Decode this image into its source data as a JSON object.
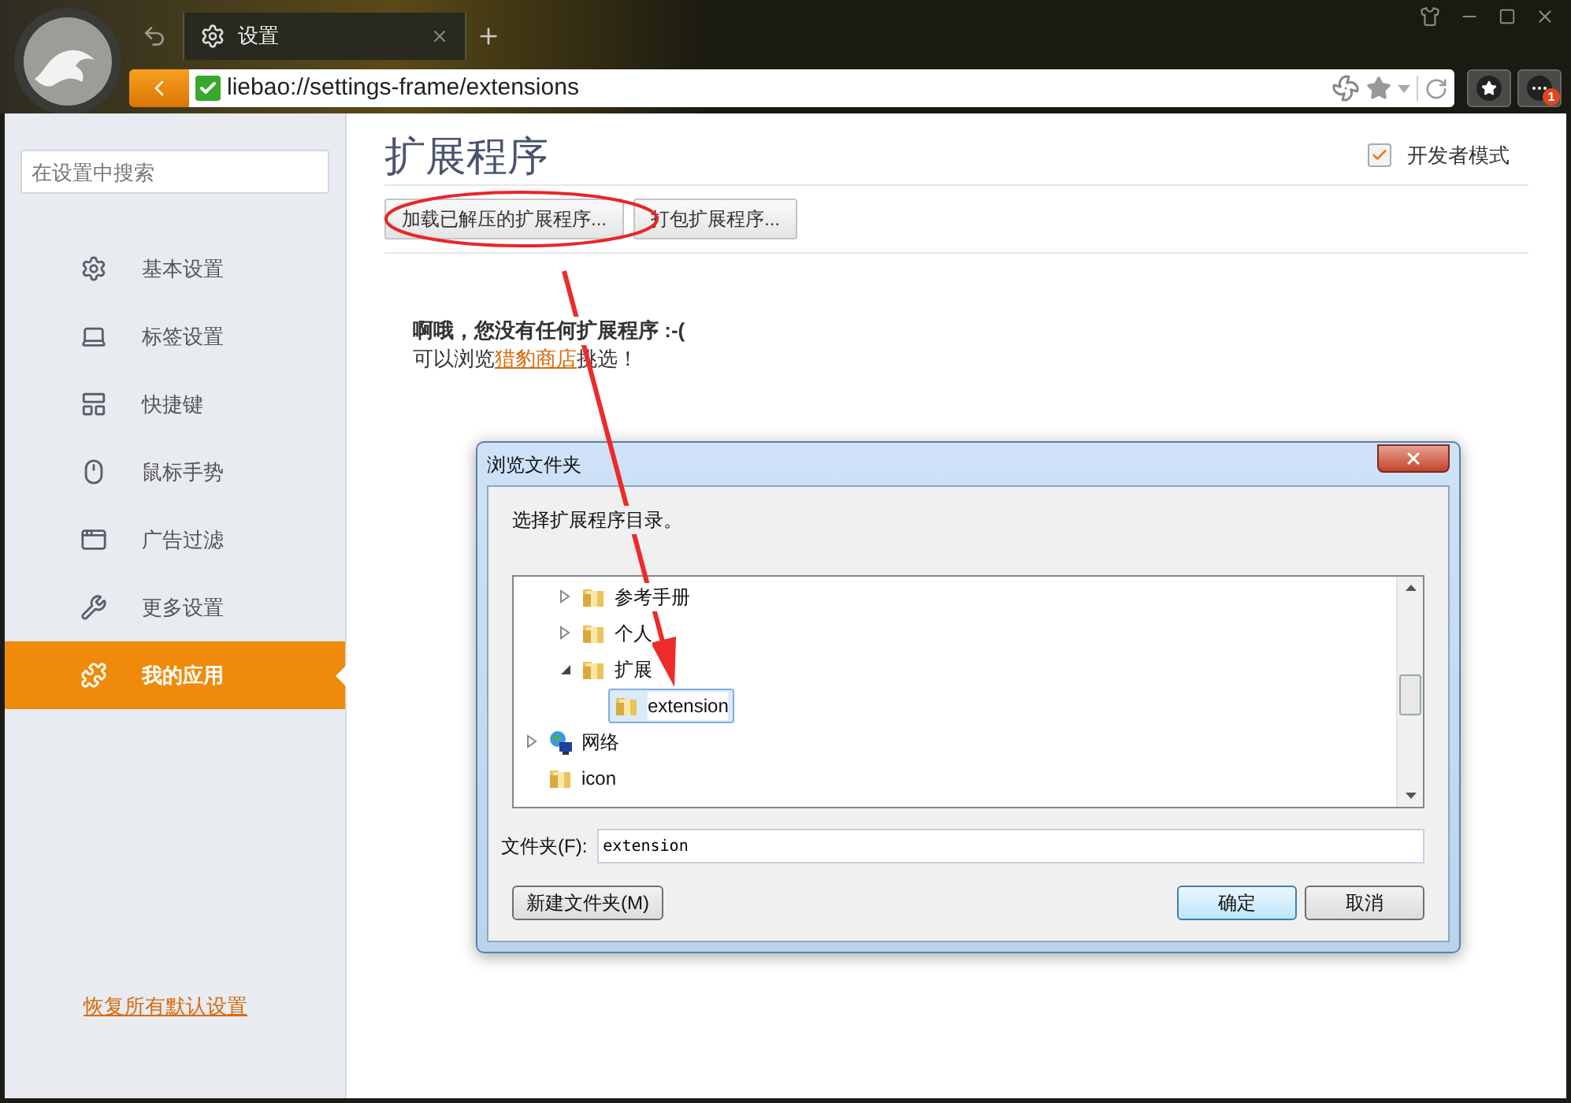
{
  "browser": {
    "tab": {
      "title": "设置",
      "selected": true
    },
    "address": "liebao://settings-frame/extensions",
    "notification_badge": "1"
  },
  "sidebar": {
    "search": {
      "placeholder": "在设置中搜索"
    },
    "items": [
      {
        "label": "基本设置",
        "selected": false
      },
      {
        "label": "标签设置",
        "selected": false
      },
      {
        "label": "快捷键",
        "selected": false
      },
      {
        "label": "鼠标手势",
        "selected": false
      },
      {
        "label": "广告过滤",
        "selected": false
      },
      {
        "label": "更多设置",
        "selected": false
      },
      {
        "label": "我的应用",
        "selected": true
      }
    ],
    "reset_link": "恢复所有默认设置"
  },
  "content": {
    "title": "扩展程序",
    "developer_mode": {
      "label": "开发者模式",
      "checked": true
    },
    "buttons": [
      "加载已解压的扩展程序...",
      "打包扩展程序..."
    ],
    "empty_message": "啊哦，您没有任何扩展程序 :-(",
    "hint": {
      "before": "可以浏览",
      "link": "猎豹商店",
      "after": "挑选！"
    }
  },
  "dialog": {
    "title": "浏览文件夹",
    "prompt": "选择扩展程序目录。",
    "tree": [
      {
        "children": [
          {
            "label": "参考手册",
            "kind": "folder",
            "expandable": true,
            "expanded": false,
            "selected": false
          },
          {
            "label": "个人",
            "kind": "folder",
            "expandable": true,
            "expanded": false,
            "selected": false
          },
          {
            "label": "扩展",
            "kind": "folder",
            "expandable": true,
            "expanded": true,
            "selected": false,
            "children": [
              {
                "label": "extension",
                "kind": "folder",
                "expandable": false,
                "selected": true
              }
            ]
          }
        ]
      },
      {
        "label": "网络",
        "kind": "network",
        "expandable": true,
        "expanded": false,
        "selected": false
      },
      {
        "label": "icon",
        "kind": "folder",
        "expandable": false,
        "selected": false
      }
    ],
    "folder_label": "文件夹(F):",
    "folder_value": "extension",
    "buttons": [
      {
        "label": "新建文件夹(M)",
        "default": false
      },
      {
        "label": "确定",
        "default": true
      },
      {
        "label": "取消",
        "default": false
      }
    ]
  }
}
